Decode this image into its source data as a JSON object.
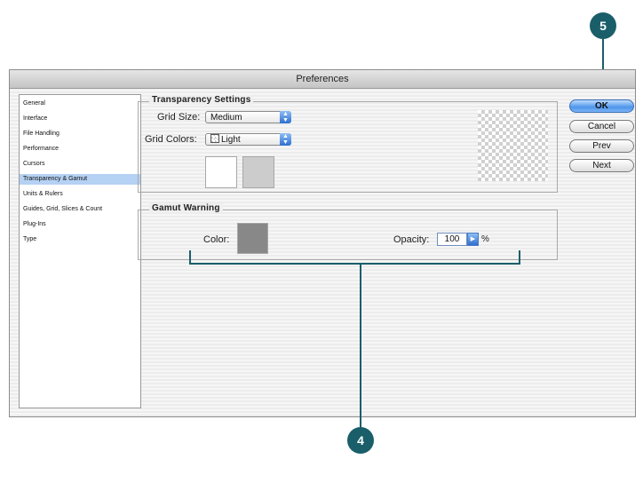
{
  "window": {
    "title": "Preferences"
  },
  "sidebar": {
    "items": [
      {
        "label": "General"
      },
      {
        "label": "Interface"
      },
      {
        "label": "File Handling"
      },
      {
        "label": "Performance"
      },
      {
        "label": "Cursors"
      },
      {
        "label": "Transparency & Gamut",
        "selected": true
      },
      {
        "label": "Units & Rulers"
      },
      {
        "label": "Guides, Grid, Slices & Count"
      },
      {
        "label": "Plug-Ins"
      },
      {
        "label": "Type"
      }
    ]
  },
  "transparency": {
    "title": "Transparency Settings",
    "grid_size_label": "Grid Size:",
    "grid_size_value": "Medium",
    "grid_colors_label": "Grid Colors:",
    "grid_colors_value": "Light",
    "swatch1_color": "#ffffff",
    "swatch2_color": "#cccccc"
  },
  "gamut": {
    "title": "Gamut Warning",
    "color_label": "Color:",
    "color_value": "#888888",
    "opacity_label": "Opacity:",
    "opacity_value": "100",
    "opacity_unit": "%"
  },
  "buttons": {
    "ok": "OK",
    "cancel": "Cancel",
    "prev": "Prev",
    "next": "Next"
  },
  "callouts": {
    "four": "4",
    "five": "5"
  },
  "colors": {
    "callout": "#1a5e6a",
    "selection": "#b5d1f3",
    "accent": "#4f95ea"
  }
}
